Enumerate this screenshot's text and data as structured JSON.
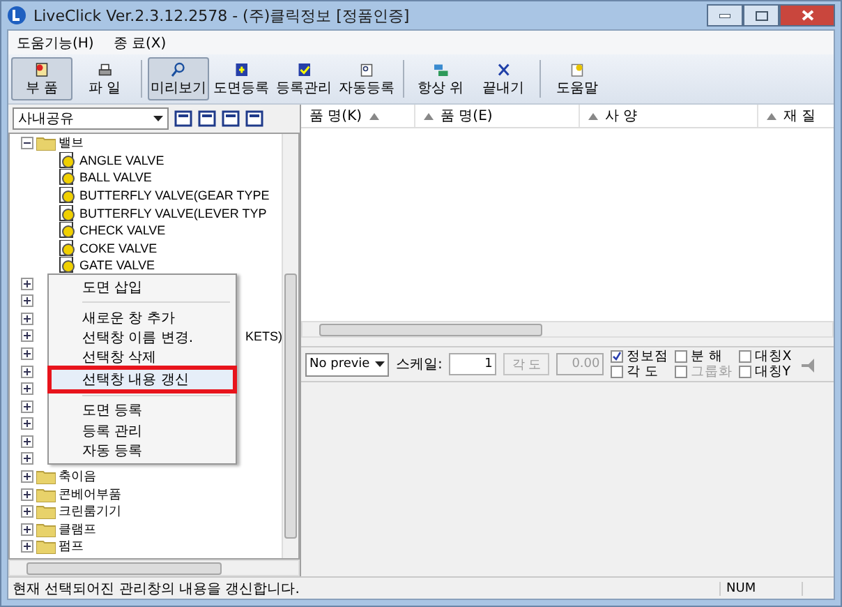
{
  "window": {
    "title": "LiveClick Ver.2.3.12.2578 - (주)클릭정보 [정품인증]"
  },
  "menu": [
    "도움기능(H)",
    "종 료(X)"
  ],
  "toolbar": [
    {
      "label": "부 품",
      "pressed": true
    },
    {
      "label": "파 일",
      "pressed": false
    },
    {
      "label": "미리보기",
      "pressed": true
    },
    {
      "label": "도면등록",
      "pressed": false
    },
    {
      "label": "등록관리",
      "pressed": false
    },
    {
      "label": "자동등록",
      "pressed": false
    },
    {
      "label": "항상 위",
      "pressed": false
    },
    {
      "label": "끝내기",
      "pressed": false
    },
    {
      "label": "도움말",
      "pressed": false
    }
  ],
  "library": {
    "value": "사내공유"
  },
  "tree": [
    {
      "label": "밸브",
      "expanded": true,
      "children": [
        {
          "label": "ANGLE VALVE"
        },
        {
          "label": "BALL VALVE"
        },
        {
          "label": "BUTTERFLY VALVE(GEAR TYPE"
        },
        {
          "label": "BUTTERFLY VALVE(LEVER TYP"
        },
        {
          "label": "CHECK VALVE"
        },
        {
          "label": "COKE VALVE"
        },
        {
          "label": "GATE VALVE"
        }
      ]
    },
    {
      "expanded": false
    },
    {
      "expanded": false
    },
    {
      "expanded": false
    },
    {
      "label": "KETS)",
      "kind": "obscured",
      "expanded": false
    },
    {
      "expanded": false
    },
    {
      "expanded": false
    },
    {
      "expanded": false
    },
    {
      "expanded": false
    },
    {
      "expanded": false
    },
    {
      "expanded": false
    },
    {
      "expanded": false
    },
    {
      "label": "축이음",
      "expanded": false
    },
    {
      "label": "콘베어부품",
      "expanded": false
    },
    {
      "label": "크린룸기기",
      "expanded": false
    },
    {
      "label": "클램프",
      "expanded": false
    },
    {
      "label": "펌프",
      "expanded": false
    }
  ],
  "context_menu": [
    {
      "label": "도면 삽입",
      "selected": false
    },
    {
      "kind": "separator"
    },
    {
      "label": "새로운 창 추가",
      "selected": false
    },
    {
      "label": "선택창 이름 변경.",
      "selected": false
    },
    {
      "label": "선택창 삭제",
      "selected": false
    },
    {
      "label": "선택창 내용 갱신",
      "selected": true
    },
    {
      "kind": "separator"
    },
    {
      "label": "도면 등록",
      "selected": false
    },
    {
      "label": "등록 관리",
      "selected": false
    },
    {
      "label": "자동 등록",
      "selected": false
    }
  ],
  "table": {
    "columns": [
      {
        "label": "품 명(K)"
      },
      {
        "label": "품 명(E)"
      },
      {
        "label": "사 양"
      },
      {
        "label": "재 질"
      }
    ]
  },
  "preview": {
    "mode": "No previe",
    "scale_label": "스케일:",
    "scale": "1",
    "angle_button": "각 도",
    "angle": "0.00",
    "checks": [
      {
        "label": "정보점",
        "checked": true,
        "disabled": false
      },
      {
        "label": "각 도",
        "checked": false,
        "disabled": false
      },
      {
        "label": "분 해",
        "checked": false,
        "disabled": false
      },
      {
        "label": "그룹화",
        "checked": false,
        "disabled": true
      },
      {
        "label": "대칭X",
        "checked": false,
        "disabled": false
      },
      {
        "label": "대칭Y",
        "checked": false,
        "disabled": false
      }
    ]
  },
  "status_bar": {
    "message": "현재 선택되어진 관리창의 내용을 갱신합니다.",
    "num": "NUM"
  }
}
